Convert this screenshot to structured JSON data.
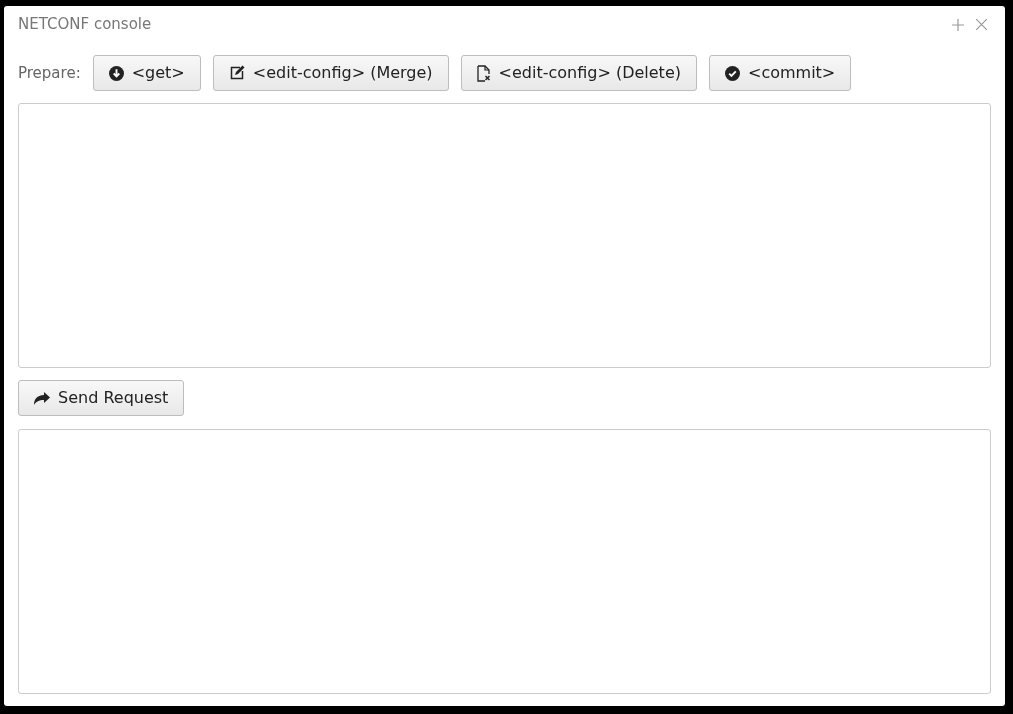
{
  "window": {
    "title": "NETCONF console"
  },
  "toolbar": {
    "label": "Prepare:",
    "buttons": [
      {
        "kind": "get",
        "label": "<get>"
      },
      {
        "kind": "merge",
        "label": "<edit-config> (Merge)"
      },
      {
        "kind": "delete",
        "label": "<edit-config> (Delete)"
      },
      {
        "kind": "commit",
        "label": "<commit>"
      }
    ]
  },
  "send_button": {
    "label": "Send Request"
  }
}
